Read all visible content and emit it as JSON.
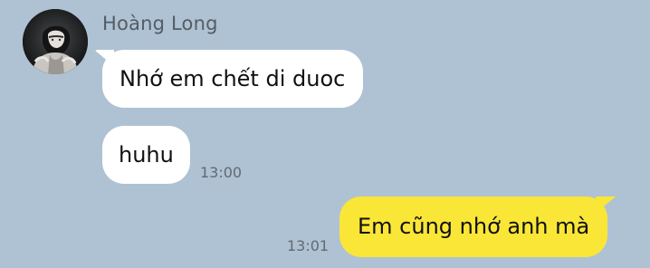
{
  "chat": {
    "contact": {
      "name": "Hoàng Long",
      "avatar_icon": "profile-photo"
    },
    "messages": [
      {
        "direction": "incoming",
        "text": "Nhớ em chết di duoc",
        "time": ""
      },
      {
        "direction": "incoming",
        "text": "huhu",
        "time": "13:00"
      },
      {
        "direction": "outgoing",
        "text": "Em cũng nhớ anh mà",
        "time": "13:01"
      }
    ]
  },
  "colors": {
    "background": "#aec2d4",
    "incoming_bubble": "#ffffff",
    "outgoing_bubble": "#fae637",
    "name_text": "#555c63",
    "timestamp_text": "#626a72"
  }
}
